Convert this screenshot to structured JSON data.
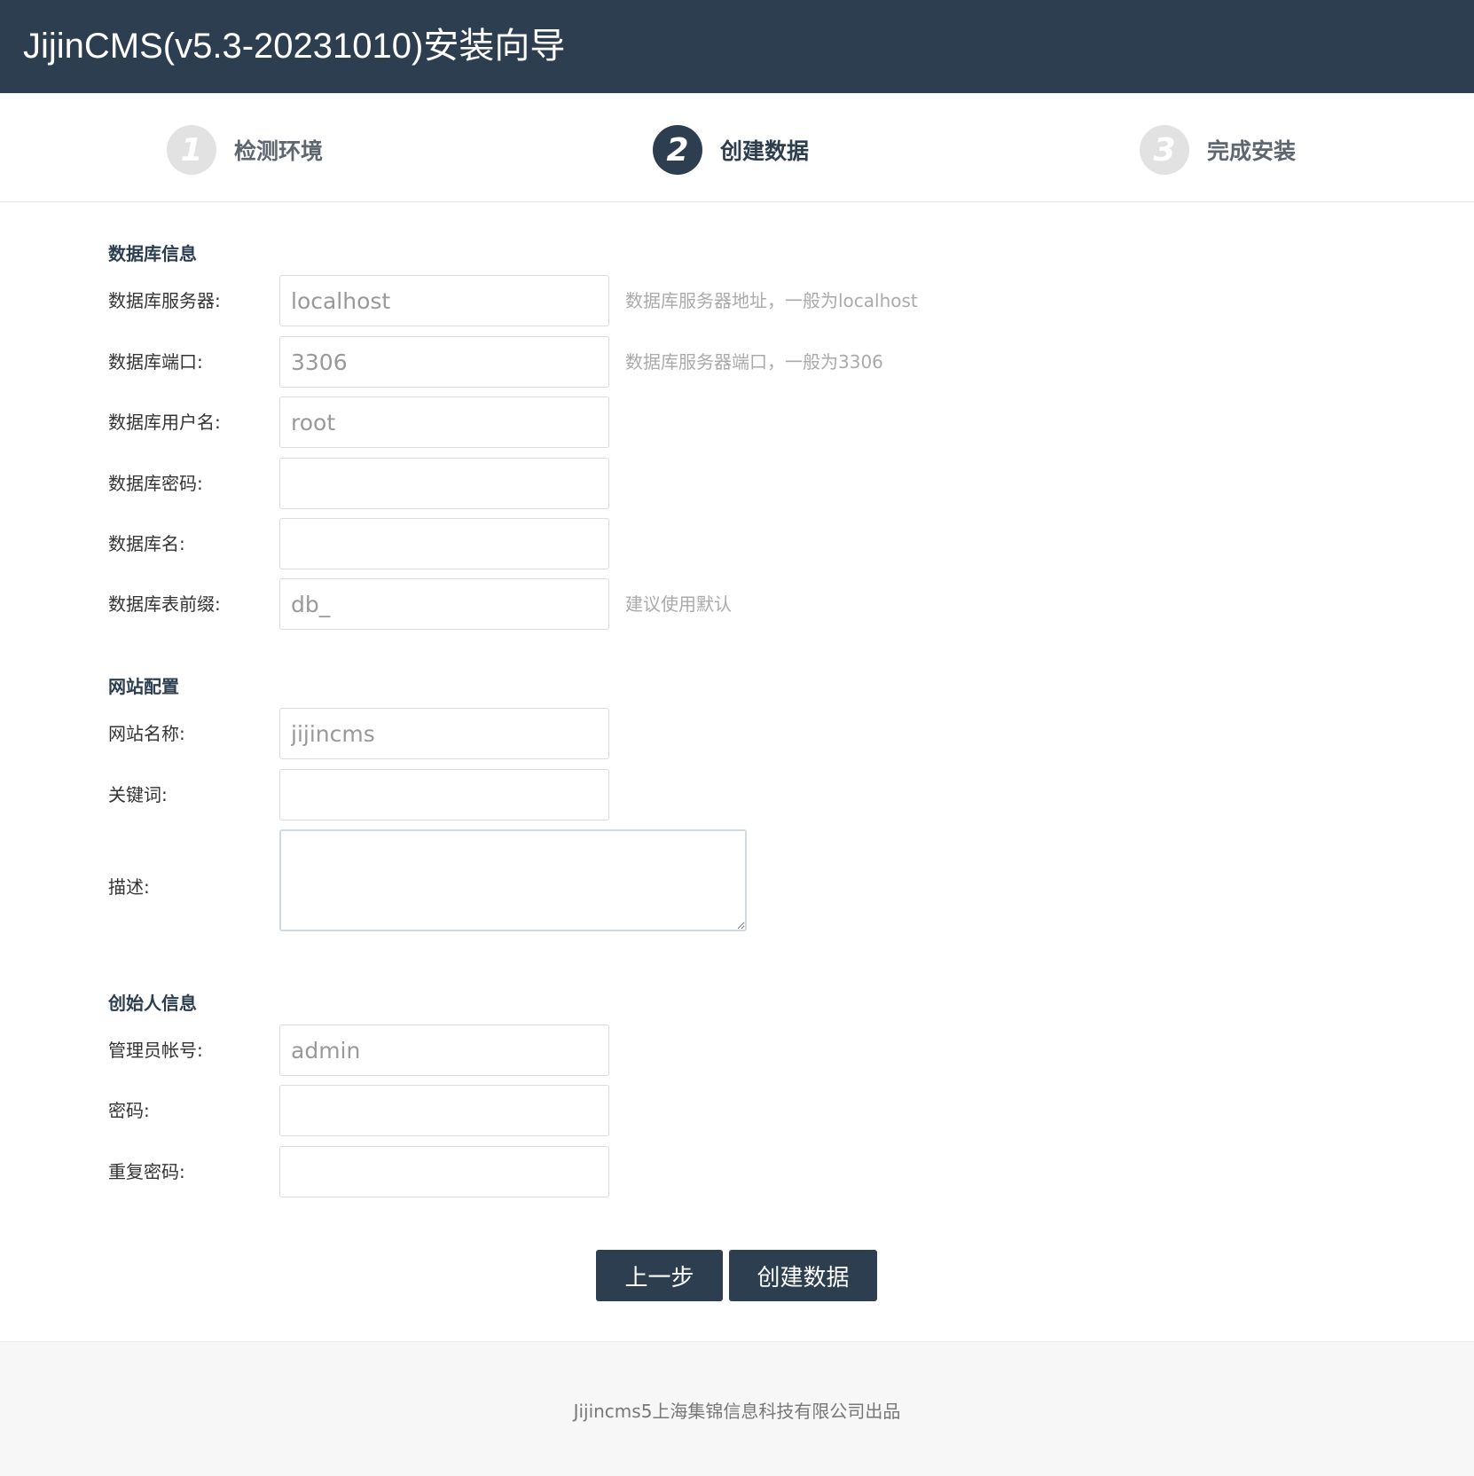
{
  "header": {
    "title": "JijinCMS(v5.3-20231010)安装向导"
  },
  "steps": [
    {
      "number": "1",
      "label": "检测环境",
      "state": "done"
    },
    {
      "number": "2",
      "label": "创建数据",
      "state": "active"
    },
    {
      "number": "3",
      "label": "完成安装",
      "state": "pending"
    }
  ],
  "db_section": {
    "title": "数据库信息",
    "server": {
      "label": "数据库服务器:",
      "value": "localhost",
      "hint": "数据库服务器地址，一般为localhost"
    },
    "port": {
      "label": "数据库端口:",
      "value": "3306",
      "hint": "数据库服务器端口，一般为3306"
    },
    "user": {
      "label": "数据库用户名:",
      "value": "root"
    },
    "password": {
      "label": "数据库密码:",
      "value": ""
    },
    "name": {
      "label": "数据库名:",
      "value": ""
    },
    "prefix": {
      "label": "数据库表前缀:",
      "value": "db_",
      "hint": "建议使用默认"
    }
  },
  "site_section": {
    "title": "网站配置",
    "site_name": {
      "label": "网站名称:",
      "value": "jijincms"
    },
    "keywords": {
      "label": "关键词:",
      "value": ""
    },
    "description": {
      "label": "描述:",
      "value": ""
    }
  },
  "founder_section": {
    "title": "创始人信息",
    "admin": {
      "label": "管理员帐号:",
      "value": "admin"
    },
    "password": {
      "label": "密码:",
      "value": ""
    },
    "repeat_password": {
      "label": "重复密码:",
      "value": ""
    }
  },
  "buttons": {
    "prev": "上一步",
    "create": "创建数据"
  },
  "footer": {
    "text": "Jijincms5上海集锦信息科技有限公司出品"
  },
  "colors": {
    "header_bg": "#2d3e50",
    "accent": "#2d3e50",
    "step_inactive": "#e2e2e2"
  }
}
